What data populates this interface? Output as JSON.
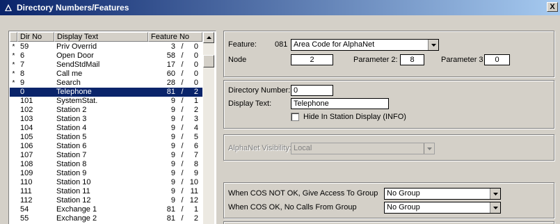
{
  "window": {
    "title": "Directory Numbers/Features",
    "close_label": "X"
  },
  "list": {
    "columns": {
      "dir_no": "Dir No",
      "display_text": "Display Text",
      "feature_no": "Feature No"
    },
    "rows": [
      {
        "mark": "*",
        "dir": "59",
        "text": "Priv Overrid",
        "fa": "3",
        "fb": "0",
        "selected": false
      },
      {
        "mark": "*",
        "dir": "6",
        "text": "Open Door",
        "fa": "58",
        "fb": "0",
        "selected": false
      },
      {
        "mark": "*",
        "dir": "7",
        "text": "SendStdMail",
        "fa": "17",
        "fb": "0",
        "selected": false
      },
      {
        "mark": "*",
        "dir": "8",
        "text": "Call me",
        "fa": "60",
        "fb": "0",
        "selected": false
      },
      {
        "mark": "*",
        "dir": "9",
        "text": "Search",
        "fa": "28",
        "fb": "0",
        "selected": false
      },
      {
        "mark": "",
        "dir": "0",
        "text": "Telephone",
        "fa": "81",
        "fb": "2",
        "selected": true
      },
      {
        "mark": "",
        "dir": "101",
        "text": "SystemStat.",
        "fa": "9",
        "fb": "1",
        "selected": false
      },
      {
        "mark": "",
        "dir": "102",
        "text": "Station 2",
        "fa": "9",
        "fb": "2",
        "selected": false
      },
      {
        "mark": "",
        "dir": "103",
        "text": "Station 3",
        "fa": "9",
        "fb": "3",
        "selected": false
      },
      {
        "mark": "",
        "dir": "104",
        "text": "Station 4",
        "fa": "9",
        "fb": "4",
        "selected": false
      },
      {
        "mark": "",
        "dir": "105",
        "text": "Station 5",
        "fa": "9",
        "fb": "5",
        "selected": false
      },
      {
        "mark": "",
        "dir": "106",
        "text": "Station 6",
        "fa": "9",
        "fb": "6",
        "selected": false
      },
      {
        "mark": "",
        "dir": "107",
        "text": "Station 7",
        "fa": "9",
        "fb": "7",
        "selected": false
      },
      {
        "mark": "",
        "dir": "108",
        "text": "Station 8",
        "fa": "9",
        "fb": "8",
        "selected": false
      },
      {
        "mark": "",
        "dir": "109",
        "text": "Station 9",
        "fa": "9",
        "fb": "9",
        "selected": false
      },
      {
        "mark": "",
        "dir": "110",
        "text": "Station 10",
        "fa": "9",
        "fb": "10",
        "selected": false
      },
      {
        "mark": "",
        "dir": "111",
        "text": "Station 11",
        "fa": "9",
        "fb": "11",
        "selected": false
      },
      {
        "mark": "",
        "dir": "112",
        "text": "Station 12",
        "fa": "9",
        "fb": "12",
        "selected": false
      },
      {
        "mark": "",
        "dir": "54",
        "text": "Exchange 1",
        "fa": "81",
        "fb": "1",
        "selected": false
      },
      {
        "mark": "",
        "dir": "55",
        "text": "Exchange 2",
        "fa": "81",
        "fb": "2",
        "selected": false
      }
    ]
  },
  "feature_panel": {
    "feature_label": "Feature:",
    "feature_code": "081",
    "feature_value": "Area Code for AlphaNet",
    "node_label": "Node",
    "node_value": "2",
    "param2_label": "Parameter 2:",
    "param2_value": "8",
    "param3_label": "Parameter 3",
    "param3_value": "0"
  },
  "directory_panel": {
    "dirnum_label": "Directory Number:",
    "dirnum_value": "0",
    "display_label": "Display Text:",
    "display_value": "Telephone",
    "hide_label": "Hide In Station Display (INFO)",
    "hide_checked": false
  },
  "alphanet_panel": {
    "visibility_label": "AlphaNet Visibility:",
    "visibility_value": "Local"
  },
  "cos_panel": {
    "not_ok_label": "When COS NOT OK, Give Access To Group",
    "not_ok_value": "No Group",
    "ok_label": "When COS OK, No Calls From Group",
    "ok_value": "No Group"
  }
}
